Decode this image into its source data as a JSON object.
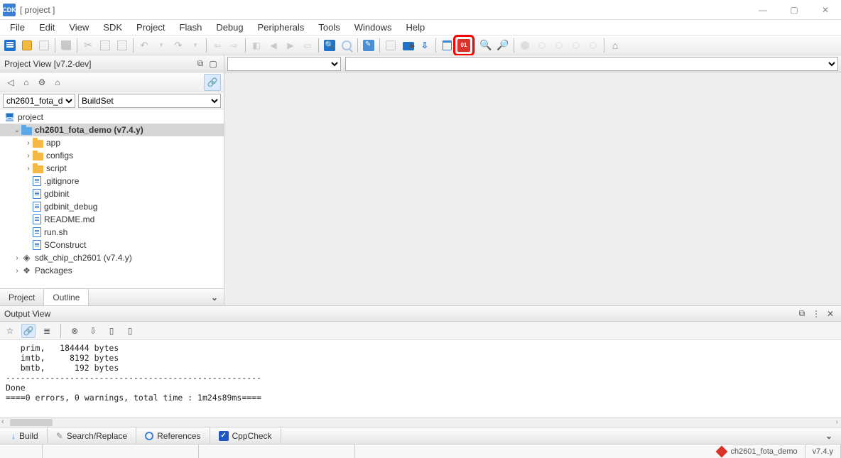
{
  "window": {
    "app_badge": "CDK",
    "title": "[ project ]"
  },
  "menubar": [
    "File",
    "Edit",
    "View",
    "SDK",
    "Project",
    "Flash",
    "Debug",
    "Peripherals",
    "Tools",
    "Windows",
    "Help"
  ],
  "toolbar_icons": [
    "new-file-icon",
    "open-file-icon",
    "close-icon",
    "sep",
    "save-icon",
    "sep",
    "cut-icon",
    "copy-icon",
    "paste-icon",
    "sep",
    "undo-icon",
    "undo-dropdown-icon",
    "redo-icon",
    "redo-dropdown-icon",
    "sep",
    "nav-back-icon",
    "nav-fwd-icon",
    "sep",
    "bookmark-toggle-icon",
    "bookmark-prev-icon",
    "bookmark-next-icon",
    "bookmark-clear-icon",
    "sep",
    "find-icon",
    "find-next-icon",
    "sep",
    "highlight-icon",
    "sep",
    "build-icon",
    "record-icon",
    "download-icon",
    "sep",
    "delete-icon",
    "hex-view-icon",
    "sep",
    "zoom-out-icon",
    "zoom-in-icon",
    "sep",
    "breakpoint-icon",
    "link1-icon",
    "link2-icon",
    "link3-icon",
    "link4-icon",
    "sep",
    "home-icon"
  ],
  "project_view": {
    "title": "Project View [v7.2-dev]",
    "dropdown_project": "ch2601_fota_d",
    "dropdown_buildset": "BuildSet",
    "nodes": {
      "root": "project",
      "main_project": "ch2601_fota_demo (v7.4.y)",
      "folders": [
        "app",
        "configs",
        "script"
      ],
      "files": [
        ".gitignore",
        "gdbinit",
        "gdbinit_debug",
        "README.md",
        "run.sh",
        "SConstruct"
      ],
      "sdk": "sdk_chip_ch2601 (v7.4.y)",
      "packages": "Packages"
    },
    "tabs": {
      "project": "Project",
      "outline": "Outline"
    }
  },
  "output": {
    "title": "Output View",
    "lines": "   prim,   184444 bytes\n   imtb,     8192 bytes\n   bmtb,      192 bytes\n----------------------------------------------------\nDone\n====0 errors, 0 warnings, total time : 1m24s89ms===="
  },
  "bottom_tabs": {
    "build": "Build",
    "search": "Search/Replace",
    "references": "References",
    "cppcheck": "CppCheck"
  },
  "status": {
    "project_name": "ch2601_fota_demo",
    "version": "v7.4.y"
  }
}
